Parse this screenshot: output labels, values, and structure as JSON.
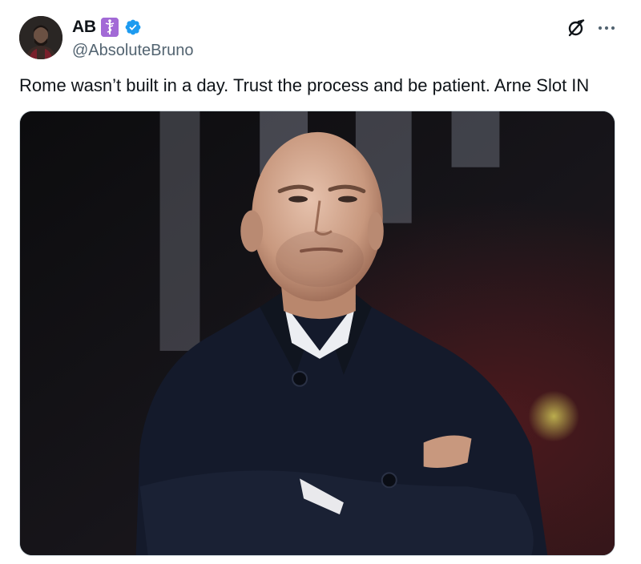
{
  "author": {
    "display_name": "AB",
    "badge_emoji": "⚕",
    "handle": "@AbsoluteBruno",
    "verified": true
  },
  "tweet": {
    "text": "Rome wasn’t built in a day. Trust the process and be patient. Arne Slot IN"
  },
  "icons": {
    "verified": "verified-badge-icon",
    "grok": "grok-icon",
    "more": "more-options-icon",
    "badge": "medical-symbol-emoji"
  },
  "colors": {
    "verified_blue": "#1d9bf0",
    "text_primary": "#0f1419",
    "text_secondary": "#536471",
    "badge_purple": "#a26ad6"
  }
}
